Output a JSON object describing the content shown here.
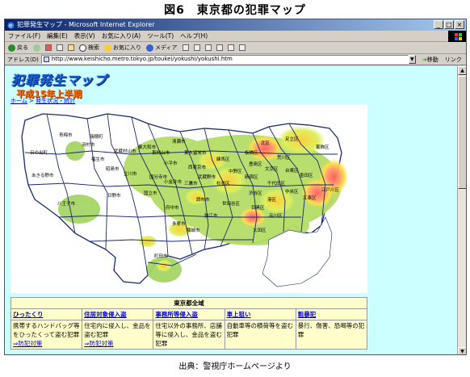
{
  "figure_title": "図6　東京都の犯罪マップ",
  "caption": "出典：警視庁ホームページより",
  "window": {
    "title": "犯罪発生マップ - Microsoft Internet Explorer",
    "buttons": [
      "_",
      "□",
      "×"
    ]
  },
  "menu": [
    "ファイル(F)",
    "編集(E)",
    "表示(V)",
    "お気に入り(A)",
    "ツール(T)",
    "ヘルプ(H)"
  ],
  "toolbar": {
    "back": "戻る",
    "search": "検索",
    "favorites": "お気に入り",
    "media": "メディア"
  },
  "address": {
    "label": "アドレス(D)",
    "url": "http://www.keishicho.metro.tokyo.jp/toukei/yokushi/yokushi.htm",
    "go": "移動",
    "links": "リンク"
  },
  "page": {
    "logo_title": "犯罪発生マップ",
    "logo_subtitle": "平成15年上半期",
    "breadcrumb_home": "ホーム",
    "breadcrumb_sep": " > ",
    "breadcrumb_page": "発生状況・統計"
  },
  "map": {
    "wards": [
      "青梅市",
      "日の出町",
      "あきる野市",
      "羽村市",
      "瑞穂町",
      "福生市",
      "武蔵村山市",
      "東大和市",
      "小平市",
      "東村山市",
      "清瀬市",
      "東久留米市",
      "西東京市",
      "練馬区",
      "板橋区",
      "北区",
      "足立区",
      "葛飾区",
      "江戸川区",
      "八王子市",
      "日野市",
      "立川市",
      "国分寺市",
      "小金井市",
      "三鷹市",
      "武蔵野市",
      "杉並区",
      "中野区",
      "新宿区",
      "豊島区",
      "文京区",
      "荒川区",
      "台東区",
      "墨田区",
      "江東区",
      "中央区",
      "千代田区",
      "港区",
      "渋谷区",
      "目黒区",
      "世田谷区",
      "品川区",
      "大田区",
      "調布市",
      "狛江市",
      "府中市",
      "多摩市",
      "稲城市",
      "町田市",
      "昭島市",
      "国立市"
    ]
  },
  "legend": {
    "title": "東京都全域",
    "categories": [
      {
        "name": "ひったくり",
        "desc": "携帯するハンドバッグ等をひったくって盗む犯罪",
        "link": "⇒防犯対策"
      },
      {
        "name": "住居対象侵入盗",
        "desc": "住宅内に侵入し、金品を盗む犯罪",
        "link": "⇒防犯対策"
      },
      {
        "name": "事務所等侵入盗",
        "desc": "住宅以外の事務所、店舗等に侵入し、金品を盗む犯罪",
        "link": ""
      },
      {
        "name": "車上狙い",
        "desc": "自動車等の積荷等を盗む犯罪",
        "link": ""
      },
      {
        "name": "粗暴犯",
        "desc": "暴行、傷害、恐喝等の犯罪",
        "link": ""
      }
    ]
  },
  "colors": {
    "low": "#99cc66",
    "mid": "#ffcc33",
    "high": "#ff6666",
    "page_bg": "#ccffff",
    "titlebar": "#0a246a"
  }
}
